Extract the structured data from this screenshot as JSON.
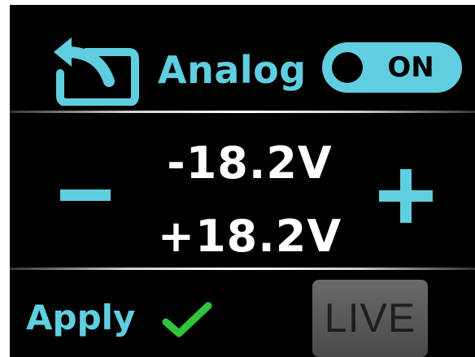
{
  "header": {
    "back_icon": "back-return-icon",
    "mode_label": "Analog",
    "toggle_label": "ON"
  },
  "voltage": {
    "negative": "-18.2V",
    "positive": "+18.2V",
    "decrease_icon": "minus-icon",
    "increase_icon": "plus-icon"
  },
  "footer": {
    "apply_label": "Apply",
    "apply_icon": "checkmark-icon",
    "live_label": "LIVE"
  },
  "colors": {
    "accent": "#5fcfe0",
    "check": "#2fc43a",
    "background": "#000000",
    "text": "#ffffff",
    "live_button": "#5a5a5a"
  }
}
